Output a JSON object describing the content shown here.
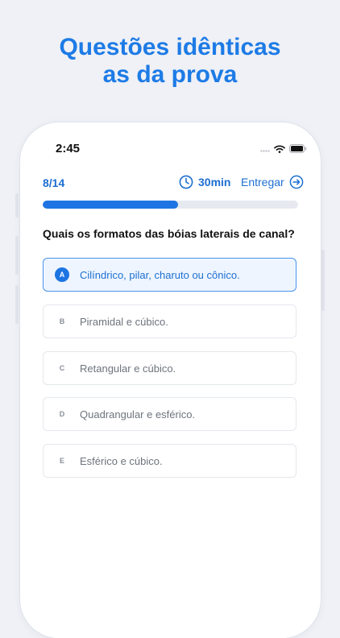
{
  "promo": {
    "line1": "Questões idênticas",
    "line2": "as da prova"
  },
  "status_bar": {
    "time": "2:45",
    "icons": [
      "signal-icon",
      "wifi-icon",
      "battery-icon"
    ]
  },
  "quiz": {
    "progress_text": "8/14",
    "progress_fraction": 0.53,
    "timer_label": "30min",
    "submit_label": "Entregar",
    "question": "Quais os formatos das bóias laterais de canal?",
    "options": [
      {
        "letter": "A",
        "text": "Cilíndrico, pilar, charuto ou cônico.",
        "selected": true
      },
      {
        "letter": "B",
        "text": "Piramidal e cúbico.",
        "selected": false
      },
      {
        "letter": "C",
        "text": "Retangular e cúbico.",
        "selected": false
      },
      {
        "letter": "D",
        "text": "Quadrangular e esférico.",
        "selected": false
      },
      {
        "letter": "E",
        "text": "Esférico e cúbico.",
        "selected": false
      }
    ]
  },
  "colors": {
    "accent": "#1d74e2",
    "selected_bg": "#eef5ff",
    "background": "#eff1f6"
  }
}
